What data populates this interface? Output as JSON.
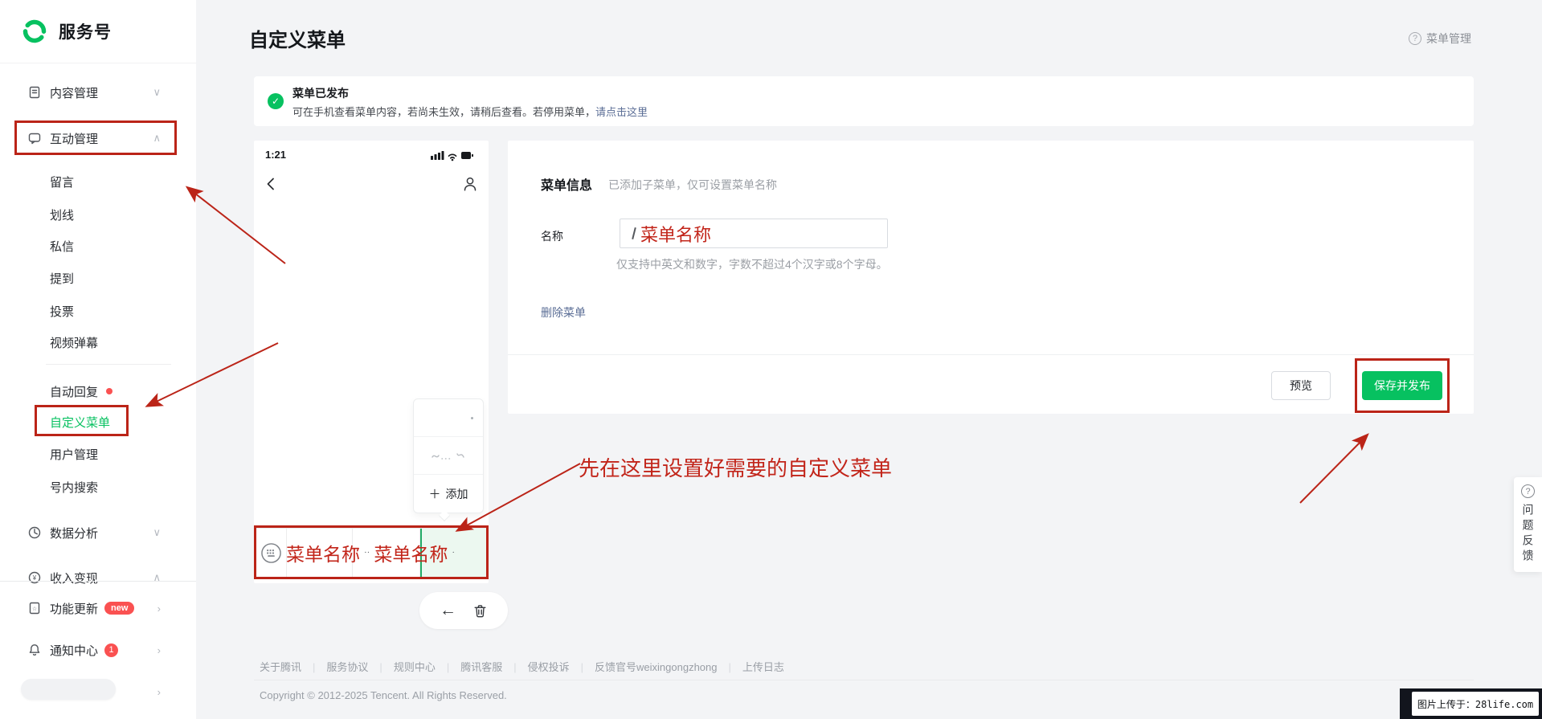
{
  "colors": {
    "brand_green": "#07c160",
    "annotation_red": "#c2251a",
    "badge_red": "#fa5151",
    "link_blue": "#5b6e96"
  },
  "icons": {
    "chevron_down": "∨",
    "chevron_up": "∧",
    "chevron_right": "›",
    "arrow_left": "←",
    "plus": "＋",
    "check": "✓",
    "question": "?",
    "dots": "··",
    "dot": "·"
  },
  "sidebar": {
    "brand": "服务号",
    "content_mgmt": "内容管理",
    "interact_mgmt": "互动管理",
    "sub_items": [
      "留言",
      "划线",
      "私信",
      "提到",
      "投票",
      "视频弹幕"
    ],
    "auto_reply": "自动回复",
    "custom_menu": "自定义菜单",
    "user_mgmt": "用户管理",
    "account_search": "号内搜索",
    "data_analysis": "数据分析",
    "income": "收入变现",
    "feature_update": "功能更新",
    "feature_badge": "new",
    "notify_center": "通知中心",
    "notify_badge": "1"
  },
  "header": {
    "title": "自定义菜单",
    "manage": "菜单管理"
  },
  "banner": {
    "title": "菜单已发布",
    "desc": "可在手机查看菜单内容，若尚未生效，请稍后查看。若停用菜单，",
    "link": "请点击这里"
  },
  "phone": {
    "time": "1:21",
    "add_label": "添加",
    "menu_names": [
      "菜单名称",
      "菜单名称"
    ]
  },
  "form": {
    "section_title": "菜单信息",
    "section_hint": "已添加子菜单，仅可设置菜单名称",
    "name_label": "名称",
    "name_value": "菜单名称",
    "helper": "仅支持中英文和数字，字数不超过4个汉字或8个字母。",
    "delete_link": "删除菜单"
  },
  "actions": {
    "preview": "预览",
    "save_publish": "保存并发布"
  },
  "annotations": {
    "tip": "先在这里设置好需要的自定义菜单"
  },
  "feedback": {
    "label": "问题反馈"
  },
  "footer": {
    "links": [
      "关于腾讯",
      "服务协议",
      "规则中心",
      "腾讯客服",
      "侵权投诉",
      "反馈官号weixingongzhong",
      "上传日志"
    ],
    "copyright": "Copyright © 2012-2025 Tencent. All Rights Reserved."
  },
  "watermark": {
    "text": "图片上传于：28life.com"
  }
}
